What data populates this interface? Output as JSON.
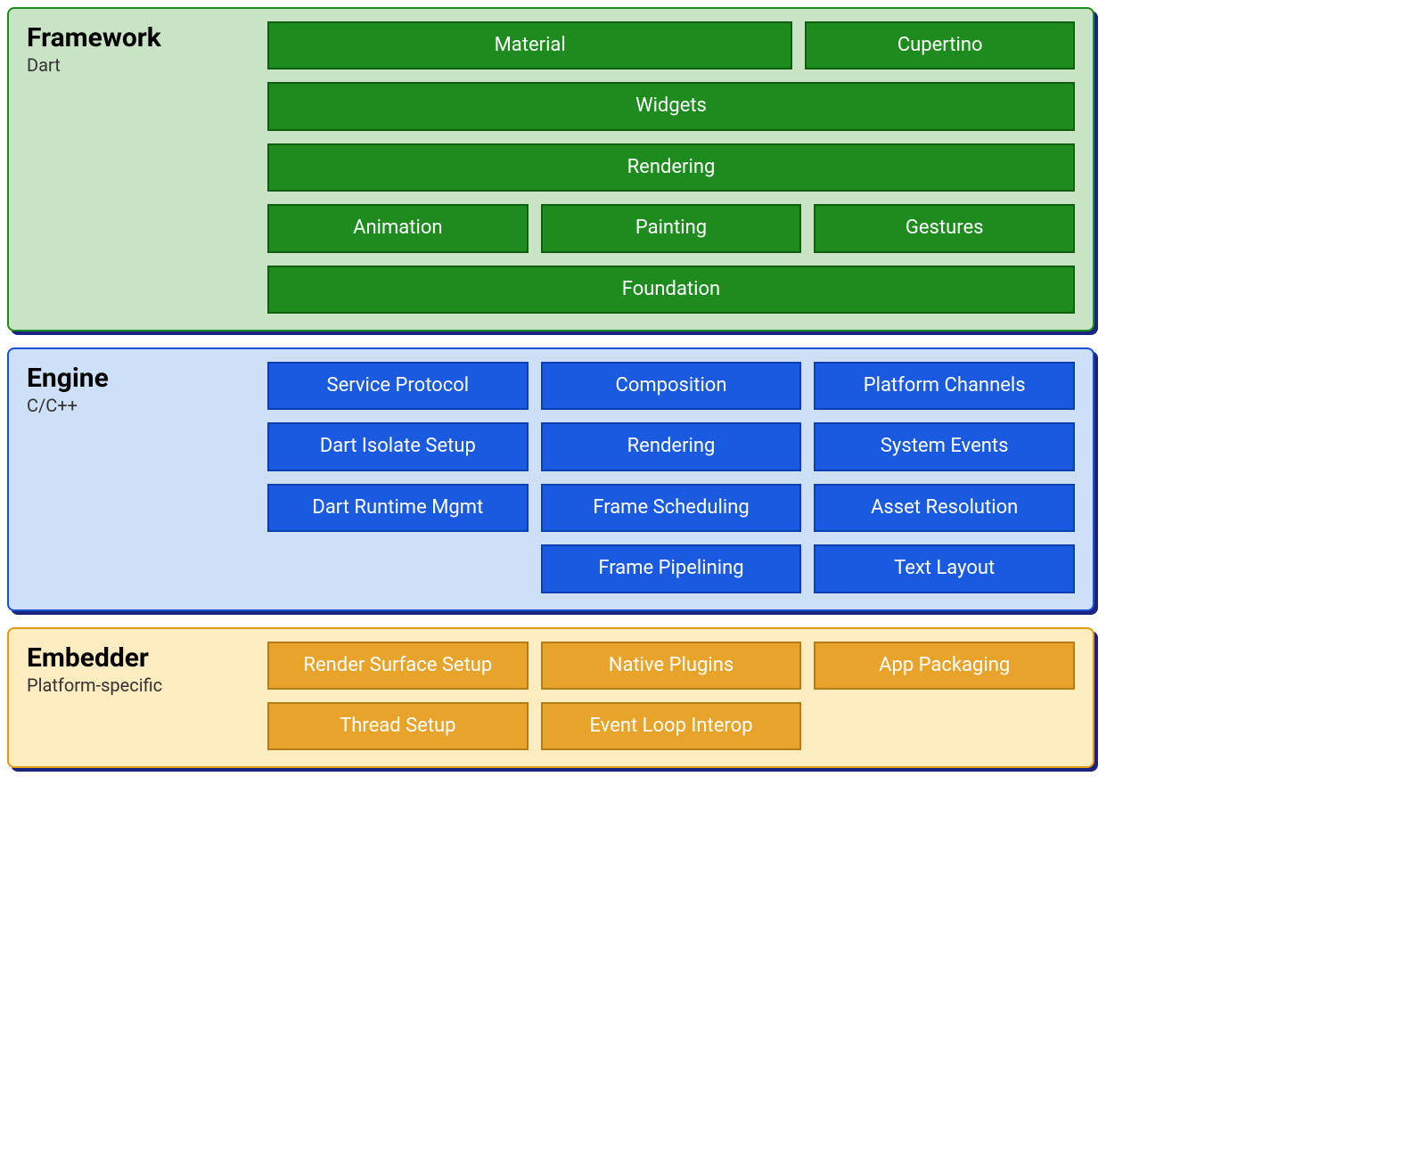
{
  "layers": [
    {
      "title": "Framework",
      "subtitle": "Dart",
      "rows": [
        {
          "blocks": [
            "Material",
            "Cupertino"
          ],
          "weights": [
            2,
            1
          ]
        },
        {
          "blocks": [
            "Widgets"
          ],
          "weights": [
            1
          ]
        },
        {
          "blocks": [
            "Rendering"
          ],
          "weights": [
            1
          ]
        },
        {
          "blocks": [
            "Animation",
            "Painting",
            "Gestures"
          ],
          "weights": [
            1,
            1,
            1
          ]
        },
        {
          "blocks": [
            "Foundation"
          ],
          "weights": [
            1
          ]
        }
      ]
    },
    {
      "title": "Engine",
      "subtitle": "C/C++",
      "rows": [
        {
          "blocks": [
            "Service Protocol",
            "Composition",
            "Platform Channels"
          ],
          "weights": [
            1,
            1,
            1
          ]
        },
        {
          "blocks": [
            "Dart Isolate Setup",
            "Rendering",
            "System Events"
          ],
          "weights": [
            1,
            1,
            1
          ]
        },
        {
          "blocks": [
            "Dart Runtime Mgmt",
            "Frame Scheduling",
            "Asset Resolution"
          ],
          "weights": [
            1,
            1,
            1
          ]
        },
        {
          "blocks": [
            "",
            "Frame Pipelining",
            "Text Layout"
          ],
          "weights": [
            1,
            1,
            1
          ],
          "hidden": [
            true,
            false,
            false
          ]
        }
      ]
    },
    {
      "title": "Embedder",
      "subtitle": "Platform-specific",
      "rows": [
        {
          "blocks": [
            "Render Surface Setup",
            "Native Plugins",
            "App Packaging"
          ],
          "weights": [
            1,
            1,
            1
          ]
        },
        {
          "blocks": [
            "Thread Setup",
            "Event Loop Interop",
            ""
          ],
          "weights": [
            1,
            1,
            1
          ],
          "hidden": [
            false,
            false,
            true
          ]
        }
      ]
    }
  ],
  "colors": {
    "framework_block": "block-green",
    "engine_block": "block-blue",
    "embedder_block": "block-orange"
  }
}
